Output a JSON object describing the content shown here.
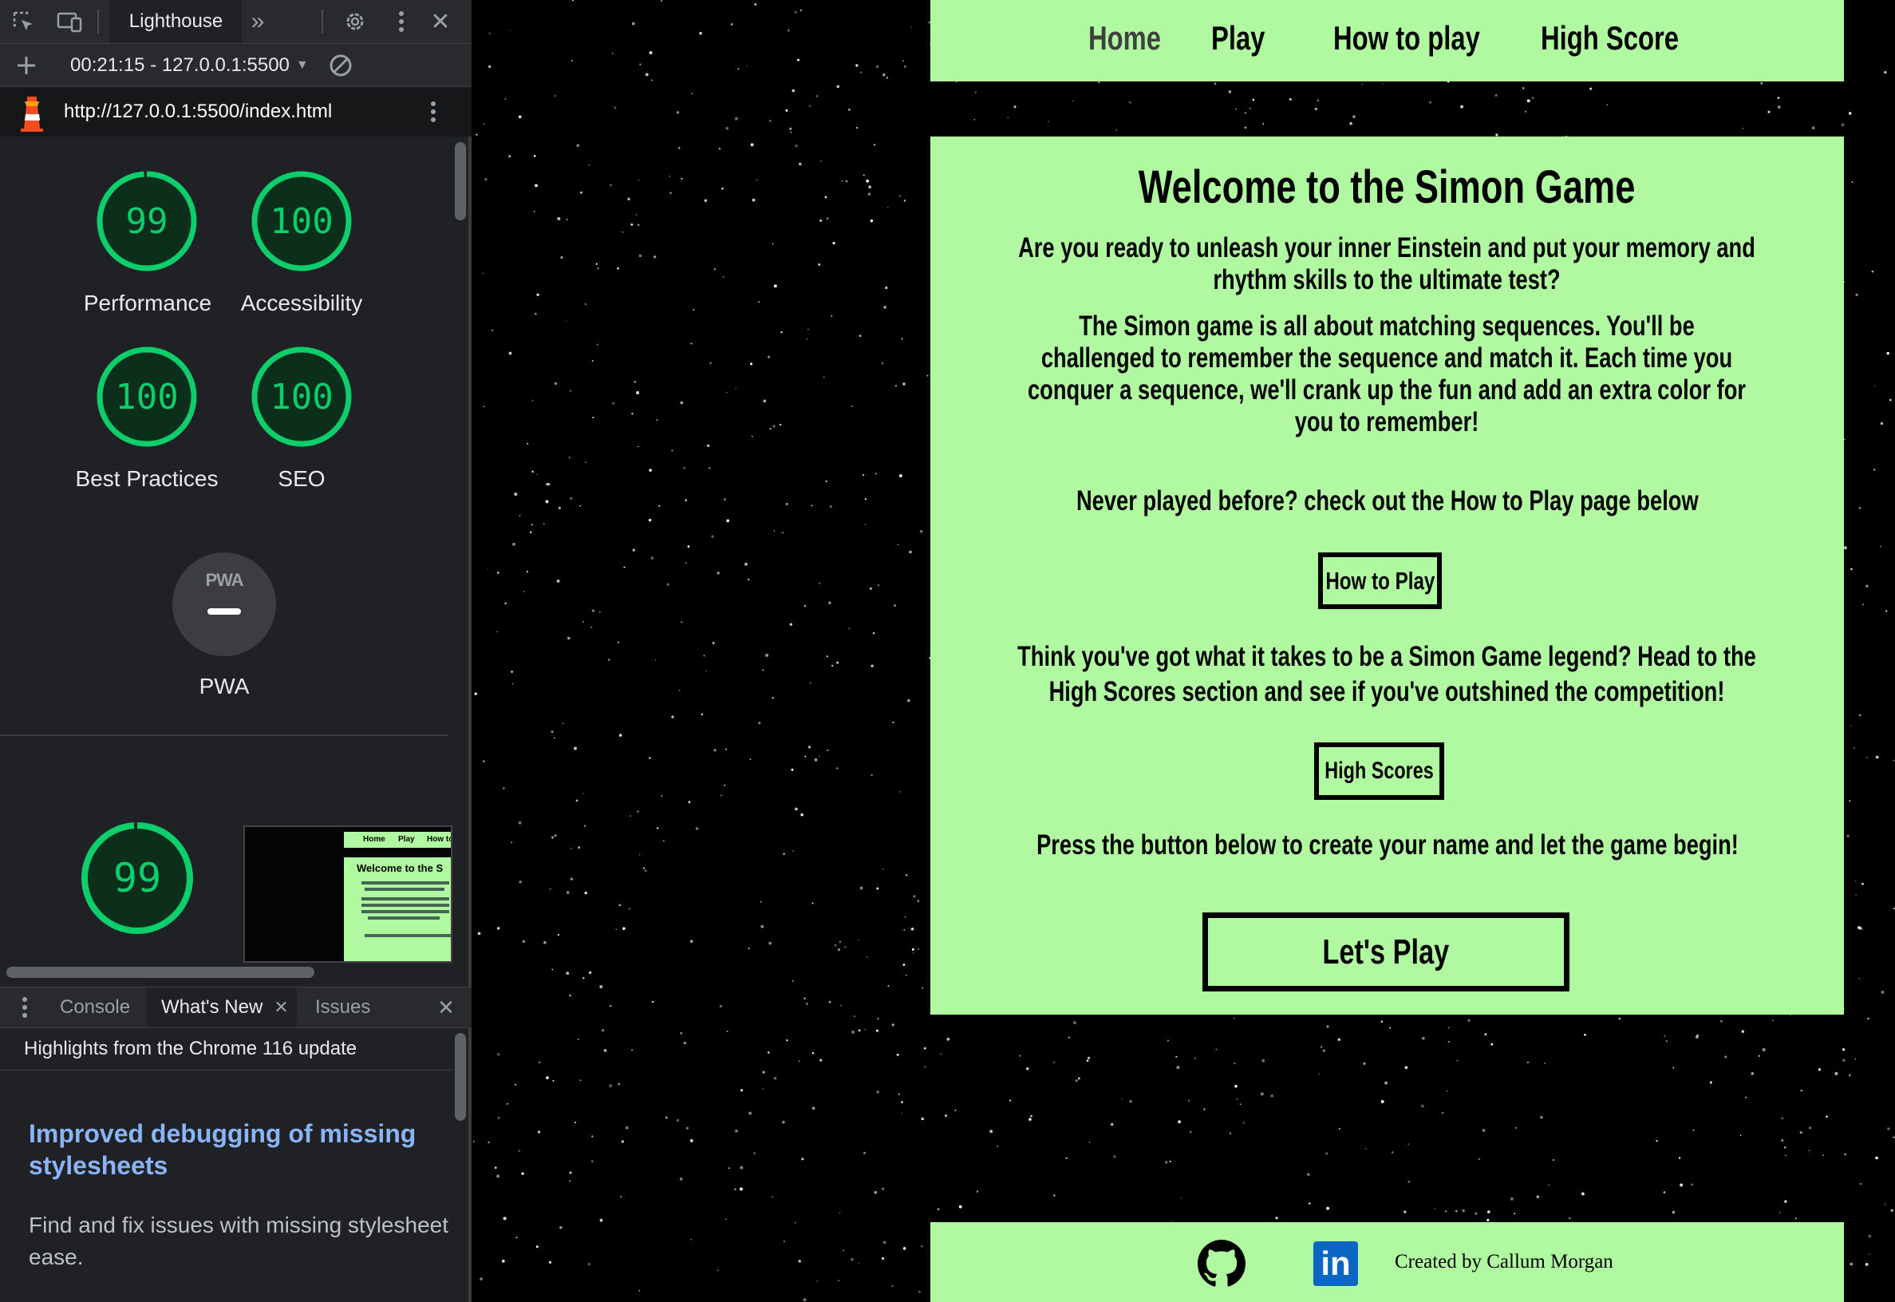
{
  "devtools": {
    "toolbar": {
      "active_tab": "Lighthouse",
      "more_tabs": "»",
      "close": "✕"
    },
    "report_selector": {
      "label": "00:21:15 - 127.0.0.1:5500"
    },
    "url": "http://127.0.0.1:5500/index.html",
    "scores": [
      {
        "label": "Performance",
        "value": "99",
        "fraction": 0.99
      },
      {
        "label": "Accessibility",
        "value": "100",
        "fraction": 1.0
      },
      {
        "label": "Best Practices",
        "value": "100",
        "fraction": 1.0
      },
      {
        "label": "SEO",
        "value": "100",
        "fraction": 1.0
      }
    ],
    "pwa": {
      "badge": "PWA",
      "label": "PWA"
    },
    "summary_score": {
      "value": "99",
      "fraction": 0.99
    },
    "thumbnail": {
      "nav": [
        "Home",
        "Play",
        "How to"
      ],
      "title": "Welcome to the S"
    },
    "drawer": {
      "tabs": [
        "Console",
        "What's New",
        "Issues"
      ],
      "active_tab": "What's New",
      "header": "Highlights from the Chrome 116 update",
      "article_title": "Improved debugging of missing stylesheets",
      "article_body": "Find and fix issues with missing stylesheet ease."
    },
    "colors": {
      "score_green": "#0cce6b",
      "link_blue": "#8ab4f8",
      "panel_bg": "#202124"
    }
  },
  "page": {
    "nav": [
      "Home",
      "Play",
      "How to play",
      "High Score"
    ],
    "title": "Welcome to the Simon Game",
    "intro": "Are you ready to unleash your inner Einstein and put your memory and rhythm skills to the ultimate test?",
    "description": "The Simon game is all about matching sequences. You'll be challenged to remember the sequence and match it. Each time you conquer a sequence, we'll crank up the fun and add an extra color for you to remember!",
    "never_played": "Never played before? check out the How to Play page below",
    "how_to_button": "How to Play",
    "legend_text": "Think you've got what it takes to be a Simon Game legend? Head to the High Scores section and see if you've outshined the competition!",
    "high_scores_button": "High Scores",
    "press_text": "Press the button below to create your name and let the game begin!",
    "play_button": "Let's Play",
    "footer_credit": "Created by Callum Morgan",
    "footer_linkedin": "in",
    "colors": {
      "panel_green": "#b0f9a0",
      "background": "#000000",
      "linkedin_blue": "#0a66c2"
    }
  }
}
